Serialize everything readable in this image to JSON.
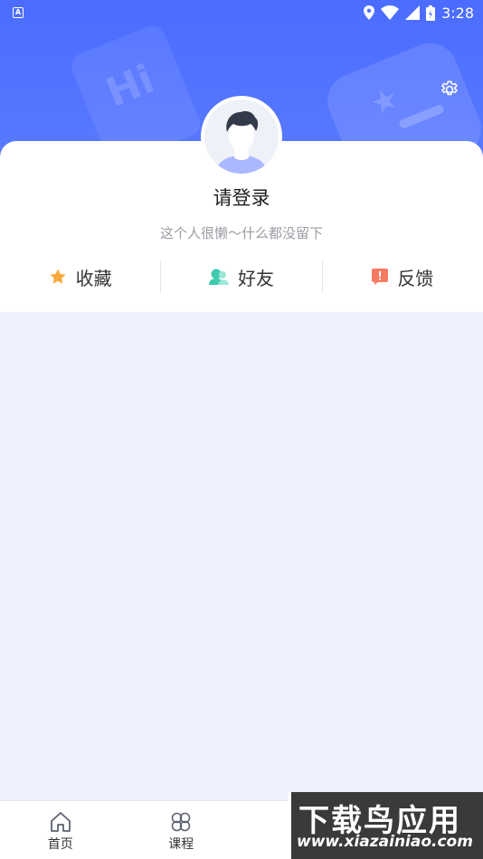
{
  "status_bar": {
    "time": "3:28",
    "notification_icon": "A"
  },
  "profile": {
    "login_prompt": "请登录",
    "bio": "这个人很懒～什么都没留下"
  },
  "header_deco": {
    "text": "Hi"
  },
  "actions": [
    {
      "label": "收藏",
      "icon": "star-icon",
      "color": "#f7a93b"
    },
    {
      "label": "好友",
      "icon": "friends-icon",
      "color": "#3ecbb0"
    },
    {
      "label": "反馈",
      "icon": "feedback-icon",
      "color": "#f77b62"
    }
  ],
  "tabbar": [
    {
      "label": "首页",
      "icon": "home-icon"
    },
    {
      "label": "课程",
      "icon": "course-icon"
    }
  ],
  "watermark": {
    "title": "下载鸟应用",
    "url": "www.xiazainiao.com"
  },
  "colors": {
    "primary": "#4b6cff",
    "page_bg": "#eef1fd"
  }
}
